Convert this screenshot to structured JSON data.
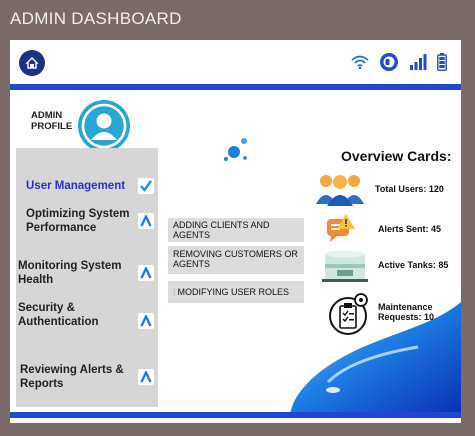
{
  "page": {
    "title": "ADMIN DASHBOARD"
  },
  "header": {
    "icons": [
      "home-icon",
      "wifi-icon",
      "toggle-icon",
      "signal-icon",
      "battery-icon"
    ],
    "colors": {
      "home": "#1d2f86",
      "accent": "#2146cf",
      "status": "#1f3fc4"
    }
  },
  "profile": {
    "label": "ADMIN PROFILE",
    "avatar_icon": "user-avatar-icon"
  },
  "sidebar": {
    "items": [
      {
        "label": "User Management",
        "icon": "check-icon"
      },
      {
        "label": "Optimizing System Performance",
        "icon": "chevron-up-icon"
      },
      {
        "label": "Monitoring System Health",
        "icon": "chevron-up-icon"
      },
      {
        "label": "Security & Authentication",
        "icon": "chevron-up-icon"
      },
      {
        "label": "Reviewing Alerts & Reports",
        "icon": "chevron-up-icon"
      }
    ]
  },
  "submenu": {
    "items": [
      {
        "label": "ADDING  CLIENTS AND AGENTS"
      },
      {
        "label": "REMOVING CUSTOMERS OR AGENTS"
      },
      {
        "label": "MODIFYING USER ROLES"
      }
    ]
  },
  "overview": {
    "title": "Overview Cards:",
    "cards": [
      {
        "label": "Total Users: 120",
        "icon": "users-icon"
      },
      {
        "label": "Alerts Sent: 45",
        "icon": "alert-message-icon"
      },
      {
        "label": "Active Tanks: 85",
        "icon": "water-tank-icon"
      },
      {
        "label": "Maintenance Requests: 10",
        "icon": "maintenance-clipboard-icon"
      }
    ]
  }
}
